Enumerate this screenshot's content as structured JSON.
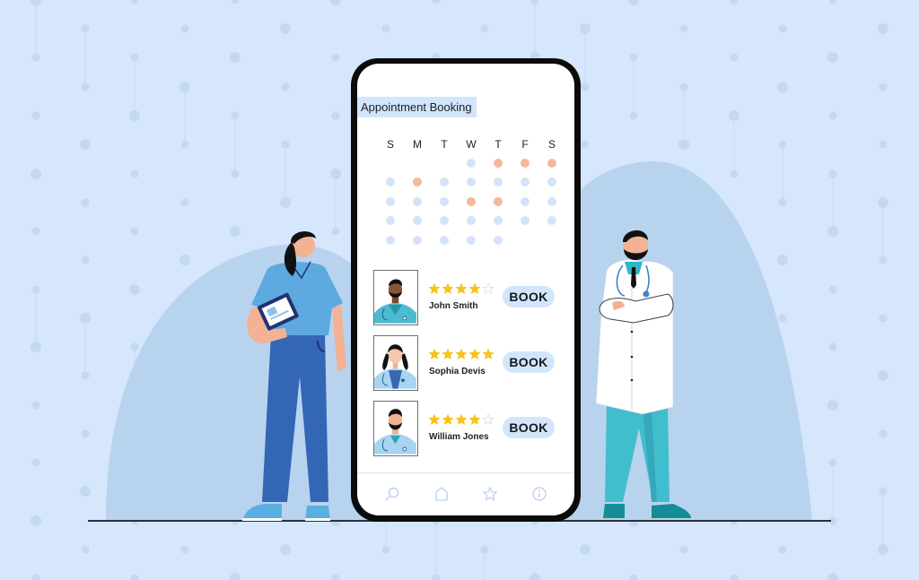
{
  "screen": {
    "title": "Appointment Booking",
    "calendar": {
      "weekdays": [
        "S",
        "M",
        "T",
        "W",
        "T",
        "F",
        "S"
      ],
      "weeks": [
        [
          "empty",
          "empty",
          "empty",
          "blue",
          "orange",
          "orange",
          "orange"
        ],
        [
          "blue",
          "orange",
          "blue",
          "blue",
          "blue",
          "blue",
          "blue"
        ],
        [
          "blue",
          "blue",
          "blue",
          "orange",
          "orange",
          "blue",
          "blue"
        ],
        [
          "blue",
          "blue",
          "blue",
          "blue",
          "blue",
          "blue",
          "blue"
        ],
        [
          "blue",
          "blue",
          "blue",
          "blue",
          "blue",
          "empty",
          "empty"
        ]
      ]
    },
    "doctors": [
      {
        "name": "John Smith",
        "rating": 4,
        "max_rating": 5,
        "book_label": "BOOK",
        "avatar": "male-doctor-scrubs-avatar"
      },
      {
        "name": "Sophia Devis",
        "rating": 5,
        "max_rating": 5,
        "book_label": "BOOK",
        "avatar": "female-doctor-avatar"
      },
      {
        "name": "William Jones",
        "rating": 4,
        "max_rating": 5,
        "book_label": "BOOK",
        "avatar": "male-doctor-coat-avatar"
      }
    ],
    "bottom_nav": [
      {
        "name": "search",
        "icon": "search-icon"
      },
      {
        "name": "home",
        "icon": "home-icon"
      },
      {
        "name": "favorites",
        "icon": "star-icon"
      },
      {
        "name": "info",
        "icon": "info-icon"
      }
    ]
  },
  "colors": {
    "background": "#D6E6FC",
    "hill": "#B8D3EE",
    "available_day": "#D4E3FA",
    "booked_day": "#F4B99A",
    "button": "#D3E5FB",
    "star_filled": "#F7C21A",
    "nav_icon": "#B9CDEE"
  },
  "illustration": {
    "left_figure": "nurse-with-clipboard",
    "right_figure": "doctor-arms-crossed"
  }
}
